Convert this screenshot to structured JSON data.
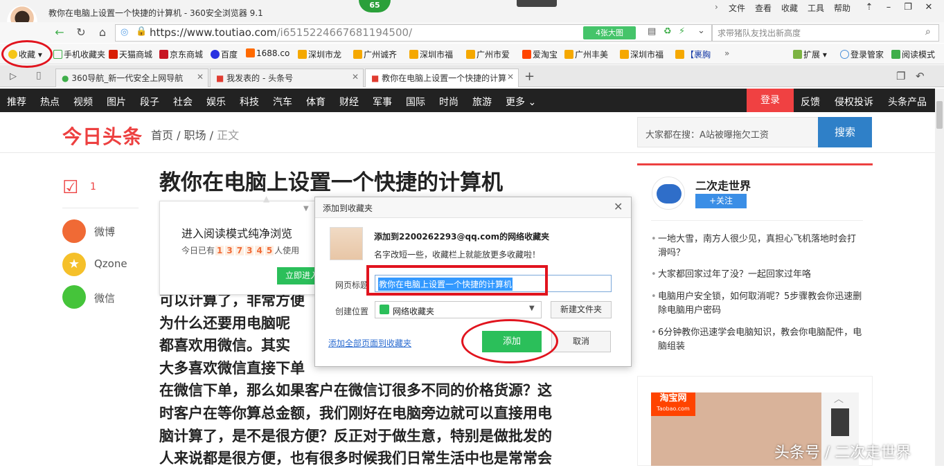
{
  "window": {
    "title": "教你在电脑上设置一个快捷的计算机 - 360安全浏览器 9.1",
    "badge": "65",
    "menus": [
      "文件",
      "查看",
      "收藏",
      "工具",
      "帮助"
    ]
  },
  "address": {
    "url_main": "https://www.toutiao.com",
    "url_path": "/i6515224667681194500/",
    "big_image_label": "4张大图",
    "search_placeholder": "求带猪队友找出新高度"
  },
  "bookmarks": {
    "favorites": "收藏",
    "items": [
      "手机收藏夹",
      "天猫商城",
      "京东商城",
      "百度",
      "1688.co",
      "深圳市龙",
      "广州诚齐",
      "深圳市福",
      "广州市爱",
      "爱淘宝",
      "广州丰美",
      "深圳市福",
      "【裹胸"
    ],
    "more": "»",
    "extensions": "扩展",
    "login_manager": "登录管家",
    "reading_mode": "阅读模式"
  },
  "tabs": [
    {
      "label": "360导航_新一代安全上网导航",
      "active": false
    },
    {
      "label": "我发表的 - 头条号",
      "active": false
    },
    {
      "label": "教你在电脑上设置一个快捷的计算",
      "active": true
    }
  ],
  "site_nav": {
    "items": [
      "推荐",
      "热点",
      "视频",
      "图片",
      "段子",
      "社会",
      "娱乐",
      "科技",
      "汽车",
      "体育",
      "财经",
      "军事",
      "国际",
      "时尚",
      "旅游",
      "更多"
    ],
    "login": "登录",
    "feedback": "反馈",
    "report": "侵权投诉",
    "products": "头条产品"
  },
  "header": {
    "logo": "今日头条",
    "breadcrumb": [
      "首页",
      "职场",
      "正文"
    ],
    "search_text": "大家都在搜：A站被曝拖欠工资",
    "search_button": "搜索"
  },
  "share": {
    "comment_count": "1",
    "weibo": "微博",
    "qzone": "Qzone",
    "wechat": "微信"
  },
  "article": {
    "title": "教你在电脑上设置一个快捷的计算机",
    "body_lines": [
      "可以计算了，非常方便",
      "为什么还要用电脑呢",
      "都喜欢用微信。其实",
      "大多喜欢微信直接下单",
      "在微信下单，那么如果客户在微信订很多不同的价格货源？这",
      "时客户在等你算总金额，我们刚好在电脑旁边就可以直接用电",
      "脑计算了，是不是很方便？反正对于做生意，特别是做批发的",
      "人来说都是很方便，也有很多时候我们日常生活中也是常常会"
    ]
  },
  "reading_popup": {
    "title": "进入阅读模式纯净浏览",
    "count_prefix": "今日已有",
    "digits": [
      "1",
      "3",
      "7",
      "3",
      "4",
      "5"
    ],
    "count_suffix": "人使用",
    "button": "立即进入"
  },
  "sidebar": {
    "author": "二次走世界",
    "follow": "+关注",
    "news": [
      "一地大雪，南方人很少见，真担心飞机落地时会打滑吗？",
      "大家都回家过年了没？一起回家过年咯",
      "电脑用户安全锁，如何取消呢？5步骤教会你迅速删除电脑用户密码",
      "6分钟教你迅速学会电脑知识，教会你电脑配件，电脑组装"
    ],
    "ad_brand": "淘宝网",
    "ad_sub": "Taobao.com"
  },
  "dialog": {
    "title": "添加到收藏夹",
    "line1": "添加到2200262293@qq.com的网络收藏夹",
    "line2": "名字改短一些，收藏栏上就能放更多收藏啦！",
    "title_label": "网页标题",
    "title_value": "教你在电脑上设置一个快捷的计算机",
    "location_label": "创建位置",
    "location_value": "网络收藏夹",
    "new_folder": "新建文件夹",
    "add_all": "添加全部页面到收藏夹",
    "add": "添加",
    "cancel": "取消"
  },
  "watermark": "头条号 / 二次走世界",
  "colors": {
    "accent_red": "#ed4040",
    "add_green": "#2bbf5a",
    "annotation_red": "#e1141e"
  }
}
